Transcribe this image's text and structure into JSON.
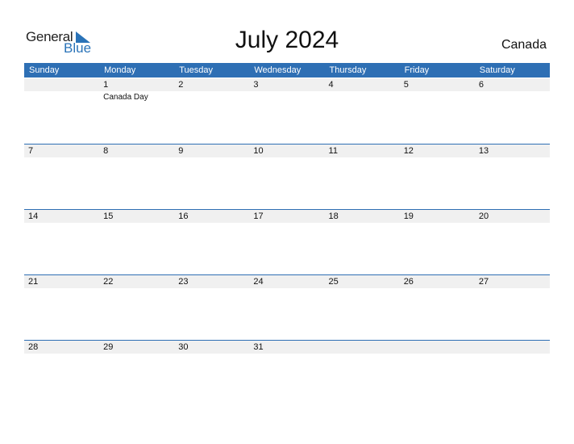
{
  "logo": {
    "general": "General",
    "blue": "Blue",
    "icon": "triangle-flag-icon"
  },
  "title": "July 2024",
  "country": "Canada",
  "colors": {
    "accent": "#2e6fb4",
    "strip": "#f0f0f0"
  },
  "weekdays": [
    "Sunday",
    "Monday",
    "Tuesday",
    "Wednesday",
    "Thursday",
    "Friday",
    "Saturday"
  ],
  "weeks": [
    {
      "days": [
        "",
        "1",
        "2",
        "3",
        "4",
        "5",
        "6"
      ],
      "events": [
        "",
        "Canada Day",
        "",
        "",
        "",
        "",
        ""
      ]
    },
    {
      "days": [
        "7",
        "8",
        "9",
        "10",
        "11",
        "12",
        "13"
      ],
      "events": [
        "",
        "",
        "",
        "",
        "",
        "",
        ""
      ]
    },
    {
      "days": [
        "14",
        "15",
        "16",
        "17",
        "18",
        "19",
        "20"
      ],
      "events": [
        "",
        "",
        "",
        "",
        "",
        "",
        ""
      ]
    },
    {
      "days": [
        "21",
        "22",
        "23",
        "24",
        "25",
        "26",
        "27"
      ],
      "events": [
        "",
        "",
        "",
        "",
        "",
        "",
        ""
      ]
    },
    {
      "days": [
        "28",
        "29",
        "30",
        "31",
        "",
        "",
        ""
      ],
      "events": [
        "",
        "",
        "",
        "",
        "",
        "",
        ""
      ]
    }
  ]
}
